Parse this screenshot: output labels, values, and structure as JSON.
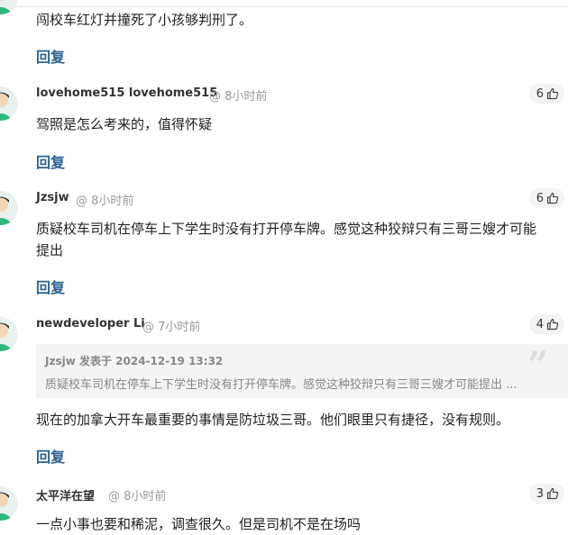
{
  "comments": [
    {
      "author": "",
      "time": "",
      "likes": "",
      "body": [
        "闯校车红灯并撞死了小孩够判刑了。"
      ],
      "reply_label": "回复"
    },
    {
      "author": "lovehome515 lovehome515",
      "time": "@ 8小时前",
      "likes": "6",
      "body": [
        "驾照是怎么考来的，值得怀疑"
      ],
      "reply_label": "回复"
    },
    {
      "author": "Jzsjw",
      "time": "@ 8小时前",
      "likes": "6",
      "body": [
        "质疑校车司机在停车上下学生时没有打开停车牌。感觉这种狡辩只有三哥三嫂才可能",
        "提出"
      ],
      "reply_label": "回复"
    },
    {
      "author": "newdeveloper Li",
      "time": "@ 7小时前",
      "likes": "4",
      "quote": {
        "head": "Jzsjw 发表于 2024-12-19 13:32",
        "text": "质疑校车司机在停车上下学生时没有打开停车牌。感觉这种狡辩只有三哥三嫂才可能提出 ..."
      },
      "body": [
        "现在的加拿大开车最重要的事情是防垃圾三哥。他们眼里只有捷径，没有规则。"
      ],
      "reply_label": "回复"
    },
    {
      "author": "太平洋在望",
      "time": "@ 8小时前",
      "likes": "3",
      "body": [
        "一点小事也要和稀泥，调查很久。但是司机不是在场吗"
      ],
      "reply_label": ""
    }
  ],
  "icons": {
    "like": "thumbs-up-icon",
    "quote": "quote-mark-icon",
    "avatar": "default-avatar-icon"
  },
  "colors": {
    "reply": "#2a6394",
    "meta": "#999999",
    "avatar_bg": "#e8f1ee",
    "avatar_figure": "#2fb878"
  }
}
